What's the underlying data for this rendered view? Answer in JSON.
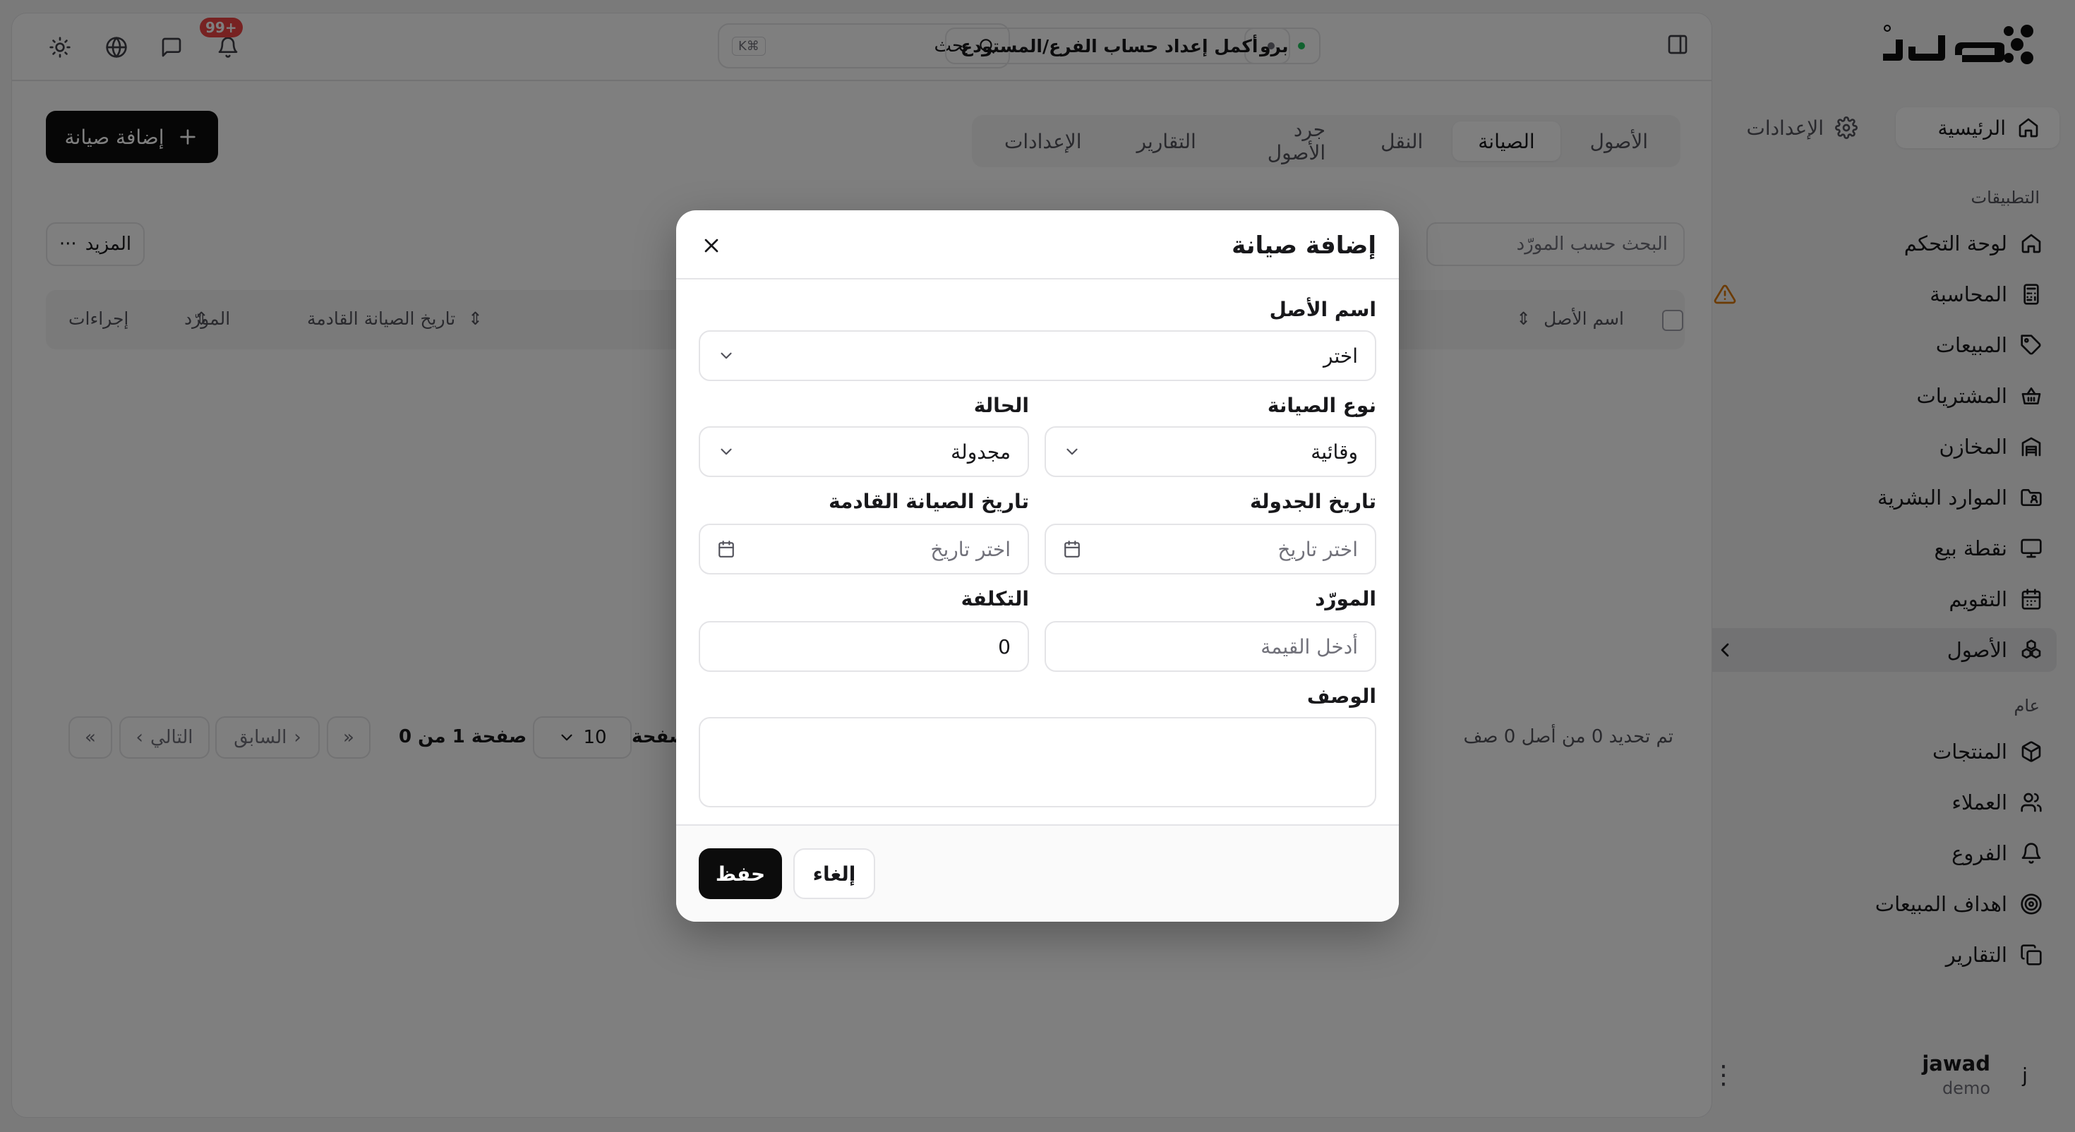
{
  "brand": {
    "logo_text": "سند"
  },
  "sidebar": {
    "home_label": "الرئيسية",
    "settings_label": "الإعدادات",
    "apps_heading": "التطبيقات",
    "general_heading": "عام",
    "apps": [
      {
        "label": "لوحة التحكم",
        "icon": "home-icon"
      },
      {
        "label": "المحاسبة",
        "icon": "calculator-icon",
        "warning": true
      },
      {
        "label": "المبيعات",
        "icon": "tag-icon"
      },
      {
        "label": "المشتريات",
        "icon": "basket-icon"
      },
      {
        "label": "المخازن",
        "icon": "warehouse-icon"
      },
      {
        "label": "الموارد البشرية",
        "icon": "folder-user-icon"
      },
      {
        "label": "نقطة بيع",
        "icon": "monitor-icon"
      },
      {
        "label": "التقويم",
        "icon": "calendar-icon"
      },
      {
        "label": "الأصول",
        "icon": "assets-icon",
        "active": true
      }
    ],
    "general": [
      {
        "label": "المنتجات",
        "icon": "box-icon"
      },
      {
        "label": "العملاء",
        "icon": "users-icon"
      },
      {
        "label": "الفروع",
        "icon": "bell-icon"
      },
      {
        "label": "اهداف المبيعات",
        "icon": "target-icon"
      },
      {
        "label": "التقارير",
        "icon": "copy-icon"
      }
    ],
    "user": {
      "initial": "j",
      "name": "jawad",
      "role": "demo"
    }
  },
  "topbar": {
    "notifications_badge": "+99",
    "search_label": "بحث",
    "search_shortcut": "K⌘",
    "setup_chip": "أكمل إعداد حساب الفرع/المستودع",
    "plan_chip": "برو"
  },
  "page": {
    "add_button": "إضافة صيانة",
    "tabs": [
      "الأصول",
      "الصيانة",
      "النقل",
      "جرد الأصول",
      "التقارير",
      "الإعدادات"
    ],
    "active_tab": "الصيانة",
    "filter_placeholder": "البحث حسب المورّد",
    "more_button": "المزيد",
    "columns": [
      "اسم الأصل",
      "تاريخ الصيانة القادمة",
      "المورّد",
      "إجراءات"
    ],
    "selection_status": "تم تحديد 0 من أصل 0 صف",
    "rows_per_page_label": "صفحة",
    "rows_per_page": "10",
    "page_info": "صفحة 1 من 0",
    "prev_label": "السابق",
    "next_label": "التالي"
  },
  "modal": {
    "title": "إضافة صيانة",
    "asset_name_label": "اسم الأصل",
    "asset_name_value": "اختر",
    "maintenance_type_label": "نوع الصيانة",
    "maintenance_type_value": "وقائية",
    "status_label": "الحالة",
    "status_value": "مجدولة",
    "scheduled_date_label": "تاريخ الجدولة",
    "scheduled_date_placeholder": "اختر تاريخ",
    "next_maintenance_label": "تاريخ الصيانة القادمة",
    "next_maintenance_placeholder": "اختر تاريخ",
    "supplier_label": "المورّد",
    "supplier_placeholder": "أدخل القيمة",
    "cost_label": "التكلفة",
    "cost_value": "0",
    "description_label": "الوصف",
    "save_button": "حفظ",
    "cancel_button": "إلغاء"
  }
}
